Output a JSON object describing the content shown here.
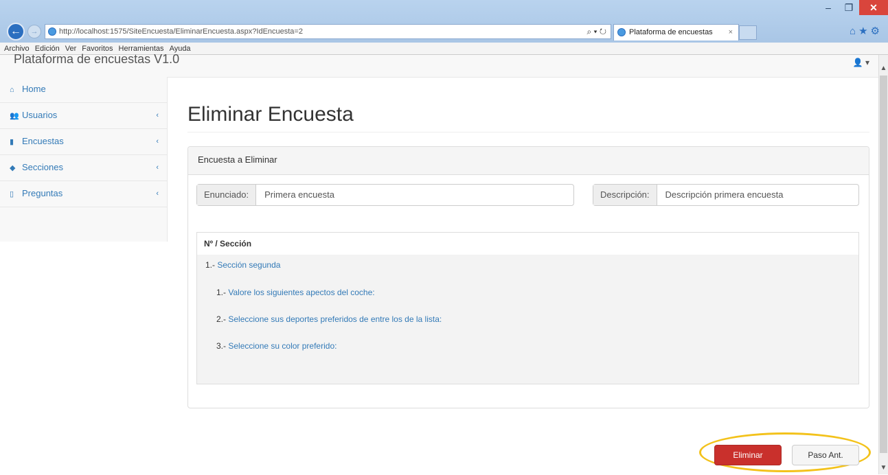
{
  "browser": {
    "url": "http://localhost:1575/SiteEncuesta/EliminarEncuesta.aspx?IdEncuesta=2",
    "url_tools": "⌕ ▾ ↻",
    "tab_title": "Plataforma de encuestas",
    "tab_close": "×",
    "menu": [
      "Archivo",
      "Edición",
      "Ver",
      "Favoritos",
      "Herramientas",
      "Ayuda"
    ],
    "minimize": "–",
    "restore": "❐",
    "close": "✕",
    "home_icon": "⌂",
    "favorites_icon": "★",
    "settings_icon": "⚙"
  },
  "app": {
    "brand": "Plataforma de encuestas V1.0",
    "user_menu": "👤 ▾"
  },
  "sidebar": {
    "items": [
      {
        "label": "Home",
        "icon": "⌂",
        "chevron": ""
      },
      {
        "label": "Usuarios",
        "icon": "👥",
        "chevron": "‹"
      },
      {
        "label": "Encuestas",
        "icon": "▮",
        "chevron": "‹"
      },
      {
        "label": "Secciones",
        "icon": "◆",
        "chevron": "‹"
      },
      {
        "label": "Preguntas",
        "icon": "▯",
        "chevron": "‹"
      }
    ]
  },
  "main": {
    "title": "Eliminar Encuesta",
    "panel_heading": "Encuesta a Eliminar",
    "enunciado_label": "Enunciado:",
    "enunciado_value": "Primera encuesta",
    "descripcion_label": "Descripción:",
    "descripcion_value": "Descripción primera encuesta",
    "table_header": "Nº / Sección",
    "section": {
      "number": "1.-",
      "name": "Sección segunda"
    },
    "questions": [
      {
        "number": "1.-",
        "text": "Valore los siguientes apectos del coche:"
      },
      {
        "number": "2.-",
        "text": "Seleccione sus deportes preferidos de entre los de la lista:"
      },
      {
        "number": "3.-",
        "text": "Seleccione su color preferido:"
      }
    ]
  },
  "buttons": {
    "delete": "Eliminar",
    "back": "Paso Ant."
  },
  "colors": {
    "link": "#337ab7",
    "danger": "#c9302c",
    "highlight": "#f3c21b"
  }
}
